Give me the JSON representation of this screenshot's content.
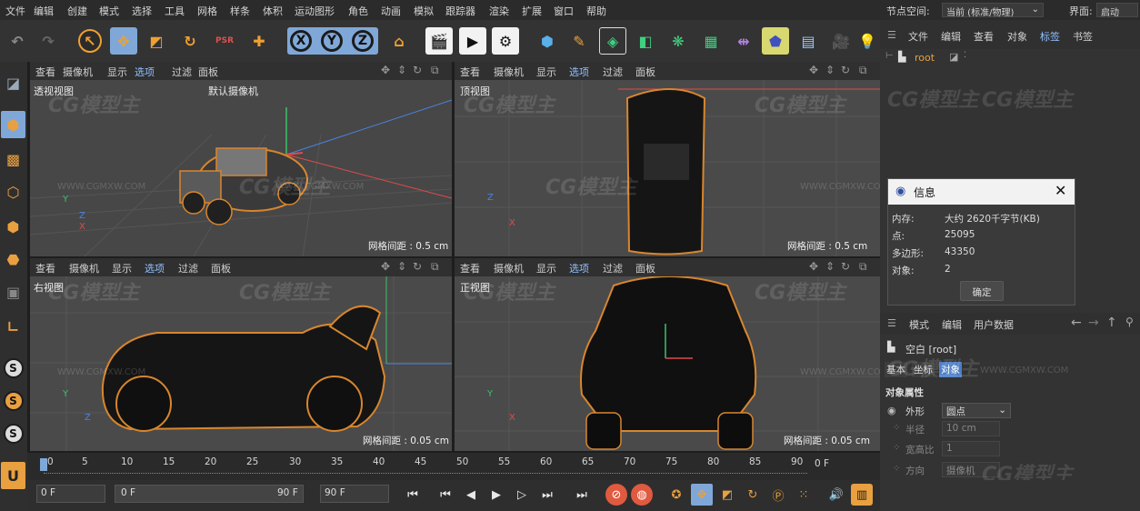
{
  "menu": [
    "文件",
    "编辑",
    "创建",
    "模式",
    "选择",
    "工具",
    "网格",
    "样条",
    "体积",
    "运动图形",
    "角色",
    "动画",
    "模拟",
    "跟踪器",
    "渲染",
    "扩展",
    "窗口",
    "帮助"
  ],
  "node_space": {
    "label": "节点空间:",
    "value": "当前 (标准/物理)"
  },
  "layout": {
    "label": "界面:",
    "value": "启动"
  },
  "toolbar": {
    "undo": "undo-icon",
    "redo": "redo-icon",
    "axis_x": "X",
    "axis_y": "Y",
    "axis_z": "Z",
    "psr": "PSR"
  },
  "viewport_menu": [
    "查看",
    "摄像机",
    "显示",
    "选项",
    "过滤",
    "面板"
  ],
  "viewports": [
    {
      "name": "透视视图",
      "camera": "默认摄像机",
      "grid": "网格间距 : 0.5 cm"
    },
    {
      "name": "顶视图",
      "grid": "网格间距 : 0.5 cm"
    },
    {
      "name": "右视图",
      "grid": "网格间距 : 0.05 cm"
    },
    {
      "name": "正视图",
      "grid": "网格间距 : 0.05 cm"
    }
  ],
  "axes": {
    "y": "Y",
    "x": "X",
    "z": "Z"
  },
  "watermark": {
    "logo": "CG模型主",
    "url": "WWW.CGMXW.COM"
  },
  "object_manager": {
    "tabs": [
      "文件",
      "编辑",
      "查看",
      "对象",
      "标签",
      "书签"
    ],
    "root": "root"
  },
  "info_dialog": {
    "title": "信息",
    "rows": [
      {
        "label": "内存:",
        "value": "大约 2620千字节(KB)"
      },
      {
        "label": "点:",
        "value": "25095"
      },
      {
        "label": "多边形:",
        "value": "43350"
      },
      {
        "label": "对象:",
        "value": "2"
      }
    ],
    "ok": "确定"
  },
  "attributes": {
    "tabs": [
      "模式",
      "编辑",
      "用户数据"
    ],
    "object": "空白 [root]",
    "subtabs": [
      "基本",
      "坐标",
      "对象"
    ],
    "section": "对象属性",
    "fields": [
      {
        "label": "外形",
        "value": "圆点"
      },
      {
        "label": "半径",
        "value": "10 cm"
      },
      {
        "label": "宽高比",
        "value": "1"
      },
      {
        "label": "方向",
        "value": "摄像机"
      }
    ]
  },
  "timeline": {
    "ticks": [
      "0",
      "5",
      "10",
      "15",
      "20",
      "25",
      "30",
      "35",
      "40",
      "45",
      "50",
      "55",
      "60",
      "65",
      "70",
      "75",
      "80",
      "85",
      "90"
    ],
    "current": "0 F"
  },
  "transport": {
    "start": "0 F",
    "range_start": "0 F",
    "range_end": "90 F",
    "end": "90 F"
  }
}
